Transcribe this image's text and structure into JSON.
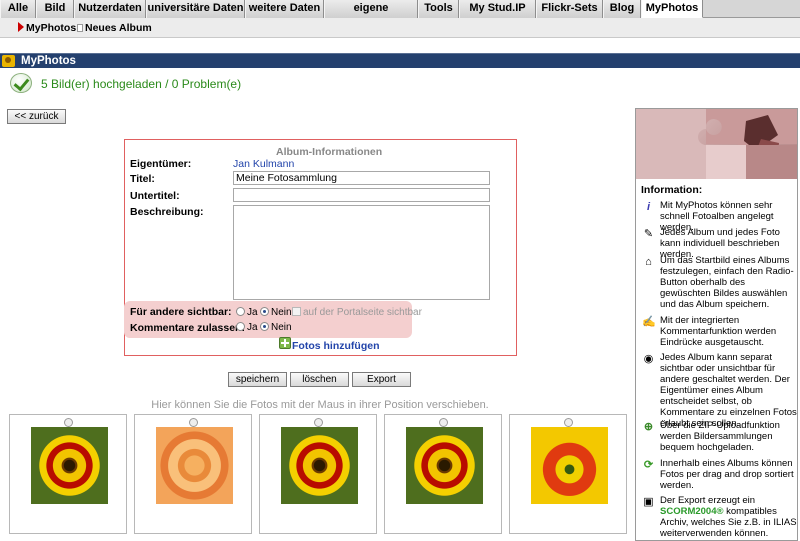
{
  "tabs": [
    {
      "label": "Alle",
      "active": false
    },
    {
      "label": "Bild",
      "active": false
    },
    {
      "label": "Nutzerdaten",
      "active": false
    },
    {
      "label": "universitäre Daten",
      "active": false
    },
    {
      "label": "weitere Daten",
      "active": false
    },
    {
      "label": "eigene Kategorien",
      "active": false
    },
    {
      "label": "Tools",
      "active": false
    },
    {
      "label": "My Stud.IP",
      "active": false
    },
    {
      "label": "Flickr-Sets",
      "active": false
    },
    {
      "label": "Blog",
      "active": false
    },
    {
      "label": "MyPhotos",
      "active": true
    }
  ],
  "subnav": {
    "myphotos": "MyPhotos",
    "new_album": "Neues Album"
  },
  "header": {
    "title": "MyPhotos"
  },
  "message": {
    "success": "5 Bild(er) hochgeladen / 0 Problem(e)"
  },
  "back_button": "<< zurück",
  "album": {
    "heading": "Album-Informationen",
    "owner_label": "Eigentümer:",
    "owner_value": "Jan Kulmann",
    "title_label": "Titel:",
    "title_value": "Meine Fotosammlung",
    "subtitle_label": "Untertitel:",
    "subtitle_value": "",
    "description_label": "Beschreibung:",
    "description_value": "",
    "visible_label": "Für andere sichtbar:",
    "visible_value": "Nein",
    "comments_label": "Kommentare zulassen:",
    "comments_value": "Nein",
    "option_yes": "Ja",
    "option_no": "Nein",
    "portal_visible_label": "auf der Portalseite sichtbar",
    "add_photos": "Fotos hinzufügen"
  },
  "actions": {
    "save": "speichern",
    "delete": "löschen",
    "export": "Export"
  },
  "drag_hint": "Hier können Sie die Fotos mit der Maus in ihrer Position verschieben.",
  "photos": [
    {
      "kind": "sun"
    },
    {
      "kind": "rose"
    },
    {
      "kind": "sun"
    },
    {
      "kind": "sun"
    },
    {
      "kind": "tulip"
    }
  ],
  "info": {
    "title": "Information:",
    "items": [
      {
        "icon": "info-icon",
        "text": "Mit MyPhotos können sehr schnell Fotoalben angelegt werden."
      },
      {
        "icon": "edit-icon",
        "text": "Jedes Album und jedes Foto kann individuell beschrieben werden."
      },
      {
        "icon": "home-icon",
        "text": "Um das Startbild eines Albums festzulegen, einfach den Radio-Button oberhalb des gewüschten Bildes auswählen und das Album speichern."
      },
      {
        "icon": "comment-icon",
        "text": "Mit der integrierten Kommentarfunktion werden Eindrücke ausgetauscht."
      },
      {
        "icon": "eye-icon",
        "text": "Jedes Album kann separat sichtbar oder unsichtbar für andere geschaltet werden. Der Eigentümer eines Album entscheidet selbst, ob Kommentare zu einzelnen Fotos erlaubt sein sollen."
      },
      {
        "icon": "upload-icon",
        "text": "Über die ZIP-Uploadfunktion werden Bildersammlungen bequem hochgeladen."
      },
      {
        "icon": "sort-icon",
        "text": "Innerhalb eines Albums können Fotos per drag and drop sortiert werden."
      },
      {
        "icon": "export-icon",
        "text_prefix": "Der Export erzeugt ein ",
        "text_highlight": "SCORM2004®",
        "text_suffix": " kompatibles Archiv, welches Sie z.B. in ILIAS weiterverwenden können."
      }
    ]
  },
  "colors": {
    "header_bg": "#24406e",
    "success_text": "#2a8a1a",
    "link": "#2244aa",
    "album_border": "#e06060",
    "visibility_highlight": "#f4cfcf"
  }
}
